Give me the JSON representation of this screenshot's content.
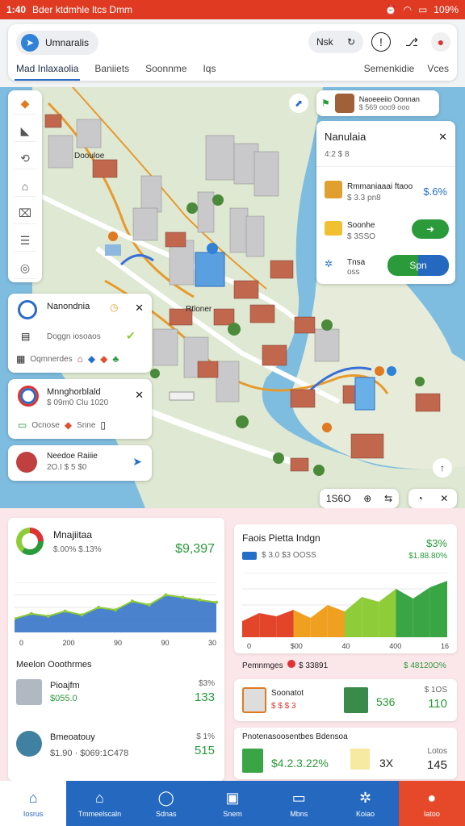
{
  "status": {
    "time": "1:40",
    "carrier": "Bder ktdmhle ltcs Dmm",
    "battery": "109%"
  },
  "header": {
    "location_label": "Umnaralis",
    "search_label": "Nsk",
    "tabs": [
      "Mad Inlaxaolia",
      "Baniiets",
      "Soonnme",
      "Iqs"
    ],
    "tabs_right": [
      "Semenkidie",
      "Vces"
    ]
  },
  "map": {
    "place_label": "Doouloe",
    "center_label": "Rtloner",
    "badge_line1": "Naoeeeiio Oonnan",
    "badge_line2": "$ 569 ooo9 ooo",
    "scale_value": "1S6O",
    "colors": {
      "water": "#7fbde0",
      "land": "#dfe8d2",
      "road": "#ffffff",
      "route": "#e79a2e"
    }
  },
  "right_panel": {
    "title": "Nanulaia",
    "sub": "4:2 $ 8",
    "row1_label": "Rmmaniaaai ftaoo",
    "row1_sub": "$ 3.3 pn8",
    "row1_value": "$.6%",
    "row2_label": "Soonhe",
    "row2_sub": "$ 3SSO",
    "row3_label": "Tnsa",
    "row3_sub": "oss",
    "btn_label": "Spn"
  },
  "left_cards": [
    {
      "title": "Nanondnia",
      "line": "Doggn iosoaos",
      "tags": [
        "Oqmnerdes"
      ]
    },
    {
      "title": "Mnnghorblald",
      "line": "$ 09m0 Clu 1020",
      "tags": [
        "Ocnose",
        "Snne"
      ]
    },
    {
      "title": "Needoe Raiiie",
      "line": "2O.I $ 5 $0"
    }
  ],
  "dashboard": {
    "left": {
      "title": "Mnajiitaa",
      "sub": "$.00%  $.13%",
      "value": "$9,397",
      "x_ticks": [
        "0",
        "200",
        "90",
        "90",
        "30"
      ],
      "section": "Meelon Ooothrmes",
      "items": [
        {
          "name": "Pioajfm",
          "sub": "$055.0",
          "pct": "$3%",
          "val": "133"
        },
        {
          "name": "Bmeoatouy",
          "sub": "$1.90 · $069:1C478",
          "pct": "$ 1%",
          "val": "515"
        }
      ]
    },
    "right": {
      "title": "Faois Pietta Indgn",
      "sub": "$ 3.0  $3 OOSS",
      "pct": "$3%",
      "pct2": "$1.88.80%",
      "x_ticks": [
        "0",
        "$00",
        "40",
        "400",
        "16"
      ],
      "legend": "Pemnmges",
      "legend_val": "$ 33891",
      "legend_right": "$ 48120O%",
      "row1": {
        "name": "Soonatot",
        "sub": "$ $ $ 3",
        "val": "536",
        "pct": "$ 1OS",
        "val2": "110"
      },
      "row2": {
        "name": "Pnotenasoosentbes Bdensoa",
        "value": "$4.2.3.22%",
        "val": "3X",
        "pct": "Lotos",
        "val2": "145"
      }
    }
  },
  "chart_data": [
    {
      "type": "area",
      "title": "Mnajiitaa",
      "x": [
        "0",
        "200",
        "90",
        "90",
        "30"
      ],
      "values": [
        22,
        30,
        26,
        34,
        28,
        40,
        36,
        50,
        44,
        60,
        56,
        52,
        48
      ],
      "color": "#2b6cc4"
    },
    {
      "type": "area",
      "title": "Faois Pietta Indgn",
      "x": [
        "0",
        "$00",
        "40",
        "400",
        "16"
      ],
      "values": [
        20,
        30,
        26,
        34,
        24,
        40,
        32,
        50,
        44,
        60,
        48,
        62,
        70
      ],
      "colors": [
        "#e2452a",
        "#f0a020",
        "#8fcc3a",
        "#3aa544"
      ]
    }
  ],
  "nav": [
    "Iosrus",
    "Tmmeelscaln",
    "Sdnas",
    "Snem",
    "Mbns",
    "Koiao",
    "Iatoo"
  ]
}
